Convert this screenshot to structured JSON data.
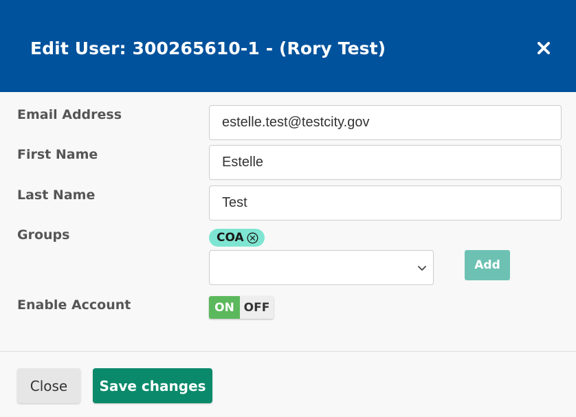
{
  "dialog": {
    "title": "Edit User: 300265610-1 - (Rory Test)",
    "close_icon": "close-icon"
  },
  "form": {
    "email": {
      "label": "Email Address",
      "value": "estelle.test@testcity.gov"
    },
    "first_name": {
      "label": "First Name",
      "value": "Estelle"
    },
    "last_name": {
      "label": "Last Name",
      "value": "Test"
    },
    "groups": {
      "label": "Groups",
      "chips": [
        {
          "label": "COA",
          "remove_icon": "circle-x-icon"
        }
      ],
      "select_value": "",
      "add_label": "Add"
    },
    "enable_account": {
      "label": "Enable Account",
      "on_label": "ON",
      "off_label": "OFF",
      "state": "on"
    }
  },
  "footer": {
    "close_label": "Close",
    "save_label": "Save changes"
  },
  "colors": {
    "header": "#00529c",
    "chip": "#7ee5d2",
    "add_button": "#6cc1b3",
    "toggle_on": "#5cb85c",
    "save_button": "#0b8a6b"
  }
}
